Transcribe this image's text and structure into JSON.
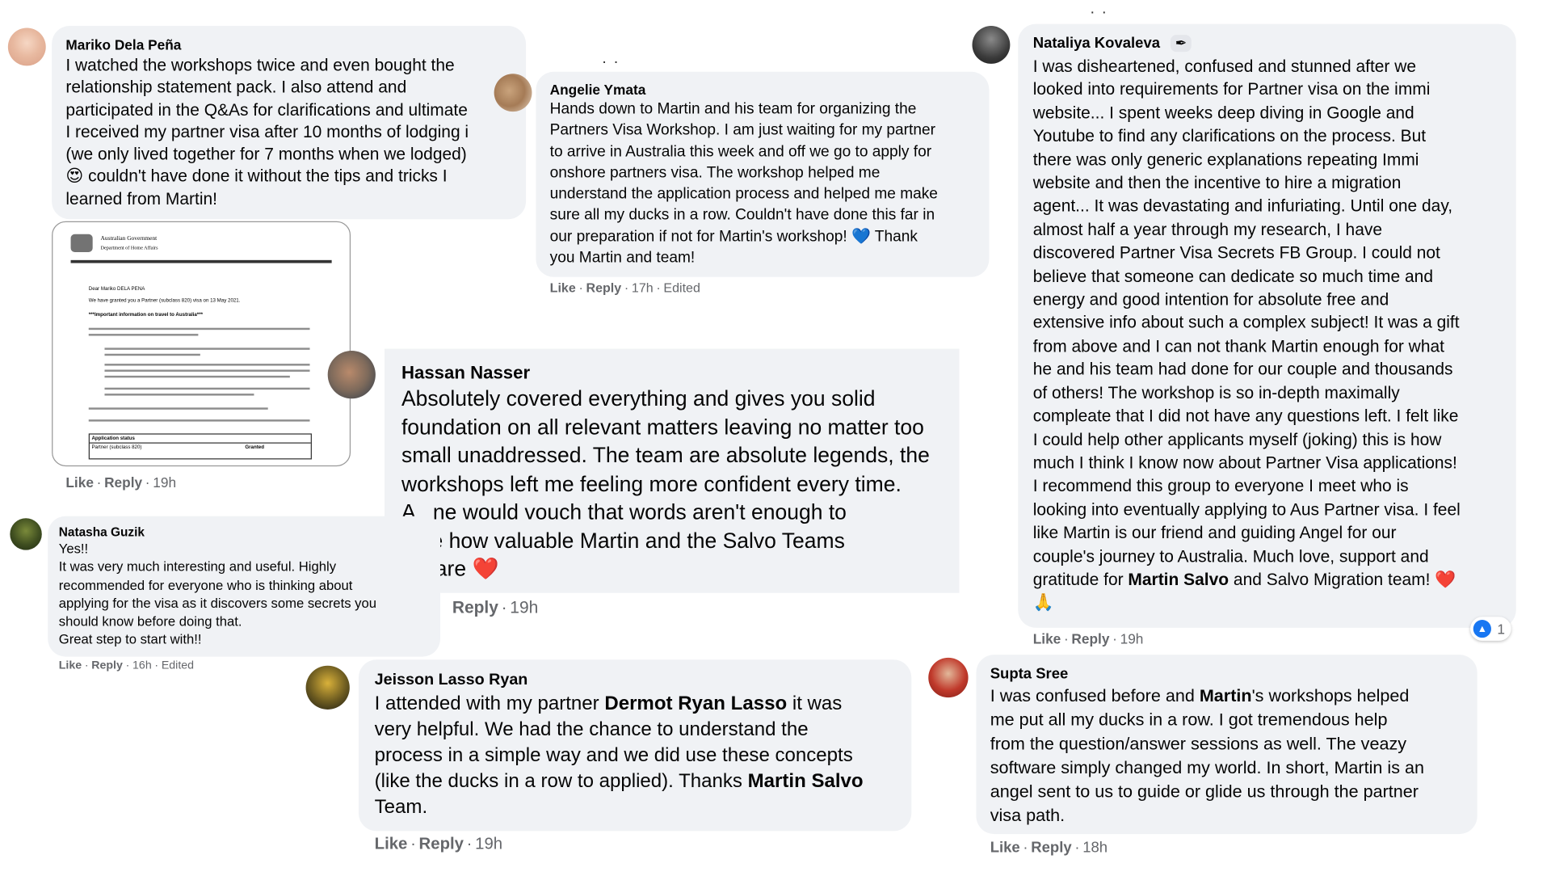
{
  "comments": [
    {
      "name": "Mariko Dela Peña",
      "lines": [
        "I watched the workshops twice and even bought the",
        "relationship statement pack. I also attend and",
        "participated in the Q&As for clarifications and ultimate",
        "I received my partner visa after 10 months of lodging i",
        "(we only lived together for 7 months when we lodged)",
        "couldn't have done it without the tips and tricks I",
        "learned from Martin!"
      ],
      "emoji": "😍",
      "like": "Like",
      "reply": "Reply",
      "time": "19h"
    },
    {
      "name": "Angelie Ymata",
      "lines": [
        "Hands down to Martin and his team for organizing the",
        "Partners Visa Workshop. I am just waiting for my partner",
        "to arrive in Australia this week and off we go to apply for",
        "onshore partners visa. The workshop helped me",
        "understand the application process and helped me make",
        "sure all my ducks in a row. Couldn't have done this far in",
        "our preparation if not for Martin's workshop! 💙 Thank",
        "you Martin and team!"
      ],
      "like": "Like",
      "reply": "Reply",
      "time": "17h",
      "edited": "Edited"
    },
    {
      "name": "Nataliya Kovaleva",
      "lines": [
        "I was disheartened, confused and stunned after we",
        "looked into requirements for Partner visa on the immi",
        "website... I spent weeks deep diving in Google and",
        "Youtube to find any clarifications on the process. But",
        "there was only generic explanations repeating Immi",
        "website and then the incentive to hire a migration",
        "agent... It was devastating and infuriating. Until one day,",
        "almost half a year through my research, I have",
        "discovered Partner Visa Secrets FB Group. I could not",
        "believe that someone can dedicate so much time and",
        "energy and good intention for absolute free and",
        "extensive info about such a complex subject! It was a gift",
        "from above and I can not thank Martin enough for what",
        "he and his team had done for our couple and thousands",
        "of others! The workshop is so in-depth maximally",
        "compleate that I did not have any questions left. I felt like",
        "I could help other applicants myself (joking) this is how",
        "much I think I know now about Partner Visa applications!",
        "I recommend this group to everyone I meet who is",
        "looking into eventually applying to Aus Partner visa. I feel",
        "like Martin is our friend and guiding Angel for our",
        "couple's journey to Australia. Much love, support and"
      ],
      "last_line_prefix": "gratitude for ",
      "last_line_bold": "Martin Salvo",
      "last_line_suffix": " and Salvo Migration team! ❤️",
      "extra_line": "🙏",
      "like": "Like",
      "reply": "Reply",
      "time": "19h",
      "reaction_count": "1"
    },
    {
      "name": "Hassan Nasser",
      "lines": [
        "Absolutely covered everything and gives you solid",
        "foundation on all relevant matters leaving no matter too",
        "small unaddressed. The team are absolute legends, the",
        "workshops left me feeling more confident every time.",
        "A    ne would vouch that words aren't enough to",
        "   ibe how valuable Martin and the Salvo Teams",
        "    s are ❤️"
      ],
      "reply": "Reply",
      "time": "19h"
    },
    {
      "name": "Natasha Guzik",
      "lines": [
        "Yes!!",
        "It was very much interesting and useful. Highly",
        "recommended for everyone who is thinking about",
        "applying for the visa as it discovers some secrets you",
        "should know before doing that.",
        "Great step to start with!!"
      ],
      "like": "Like",
      "reply": "Reply",
      "time": "16h",
      "edited": "Edited"
    },
    {
      "name": "Jeisson Lasso Ryan",
      "line1_prefix": "I attended with my partner ",
      "line1_bold": "Dermot Ryan Lasso",
      "line1_suffix": " it was",
      "lines": [
        "very helpful. We had the chance to understand the",
        "process in a simple way and we did use these concepts"
      ],
      "line4_prefix": "(like the ducks in a row to applied). Thanks ",
      "line4_bold": "Martin Salvo",
      "line5": "Team.",
      "like": "Like",
      "reply": "Reply",
      "time": "19h"
    },
    {
      "name": "Supta Sree",
      "line1_prefix": "I was confused before and ",
      "line1_bold": "Martin",
      "line1_suffix": "'s workshops helped",
      "lines": [
        "me put all my ducks in a row. I got tremendous help",
        "from the question/answer sessions as well. The veazy",
        "software simply changed my world. In short, Martin is an",
        "angel sent to us to guide or glide us through the partner",
        "visa path."
      ],
      "like": "Like",
      "reply": "Reply",
      "time": "18h"
    }
  ],
  "document": {
    "header1": "Australian Government",
    "header2": "Department of Home Affairs",
    "greeting": "Dear Mariko DELA PENA",
    "intro": "We have granted you a Partner (subclass 820) visa on 13 May 2021.",
    "heading": "***Important information on travel to Australia***",
    "status_title": "Application status",
    "status_row": "Partner (subclass 820)",
    "status_value": "Granted"
  },
  "icons": {
    "pencil": "✒",
    "like_reaction": "👍"
  },
  "colors": {
    "bubble": "#f0f2f5",
    "meta": "#65676b",
    "like_blue": "#1877f2",
    "heart": "#e0245e"
  }
}
